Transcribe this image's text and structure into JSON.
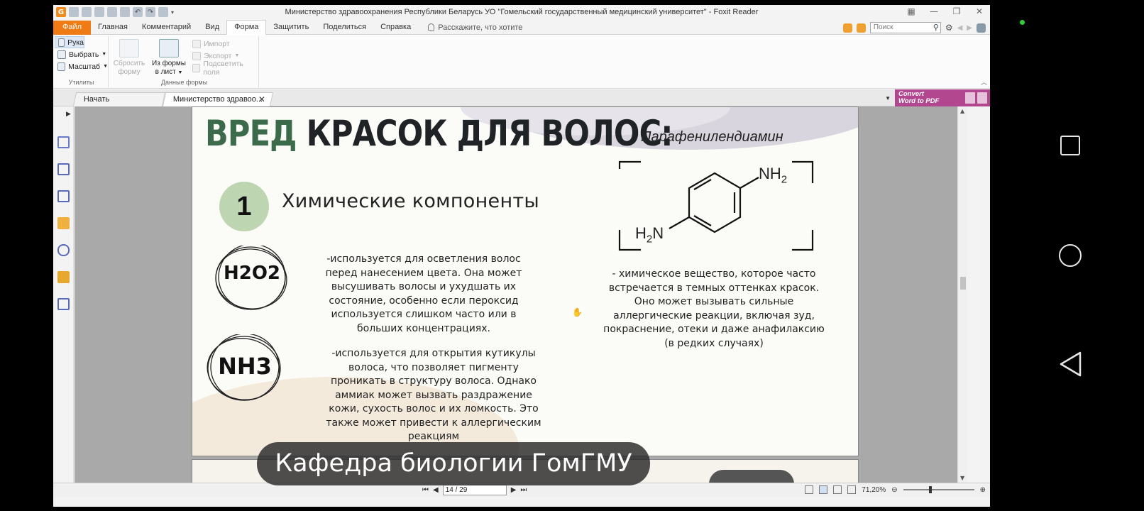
{
  "window": {
    "title": "Министерство здравоохранения Республики Беларусь УО \"Гомельский государственный медицинский университет\" - Foxit Reader"
  },
  "ribbon_tabs": [
    "Файл",
    "Главная",
    "Комментарий",
    "Вид",
    "Форма",
    "Защитить",
    "Поделиться",
    "Справка"
  ],
  "active_tab": "Форма",
  "tell_me": "Расскажите, что хотите",
  "search": {
    "placeholder": "Поиск"
  },
  "ribbon": {
    "utilities": {
      "name": "Утилиты",
      "hand": "Рука",
      "select": "Выбрать",
      "zoom": "Масштаб"
    },
    "form_data": {
      "name": "Данные формы",
      "reset_line1": "Сбросить",
      "reset_line2": "форму",
      "from_form_line1": "Из формы",
      "from_form_line2": "в лист",
      "import": "Импорт",
      "export": "Экспорт",
      "highlight": "Подсветить поля"
    }
  },
  "doc_tabs": {
    "start": "Начать",
    "current": "Министерство здравоо..."
  },
  "convert_banner": {
    "line1": "Convert",
    "line2": "Word to PDF"
  },
  "page": {
    "heading_green": "ВРЕД",
    "heading_dark": "КРАСОК ДЛЯ ВОЛОС:",
    "chem_name": "Парафенилендиамин",
    "section_number": "1",
    "section_title": "Химические компоненты",
    "formula1": "H2O2",
    "formula2": "NH3",
    "text1": "-используется для осветления волос перед нанесением цвета. Она может высушивать волосы и ухудшать их состояние, особенно если пероксид используется слишком часто или в больших концентрациях.",
    "text2": "-используется для открытия кутикулы волоса, что позволяет пигменту проникать в структуру волоса. Однако аммиак может вызвать раздражение кожи, сухость волос и их ломкость. Это также может привести к аллергическим реакциям",
    "text3": "- химическое вещество, которое часто встречается в темных оттенках красок. Оно может вызывать сильные аллергические реакции, включая зуд, покраснение, отеки и даже анафилаксию (в редких случаях)",
    "structure": {
      "top_group": "NH",
      "top_sub": "2",
      "bottom_group_pre": "H",
      "bottom_sub": "2",
      "bottom_group_post": "N"
    }
  },
  "caption": "Кафедра биологии ГомГМУ",
  "status": {
    "page_indicator": "14 / 29",
    "zoom": "71,20%"
  },
  "colors": {
    "file_tab": "#f07b14",
    "convert_banner": "#b2478f",
    "heading_green": "#3b6b4a",
    "number_circle": "#bdd6b1"
  }
}
